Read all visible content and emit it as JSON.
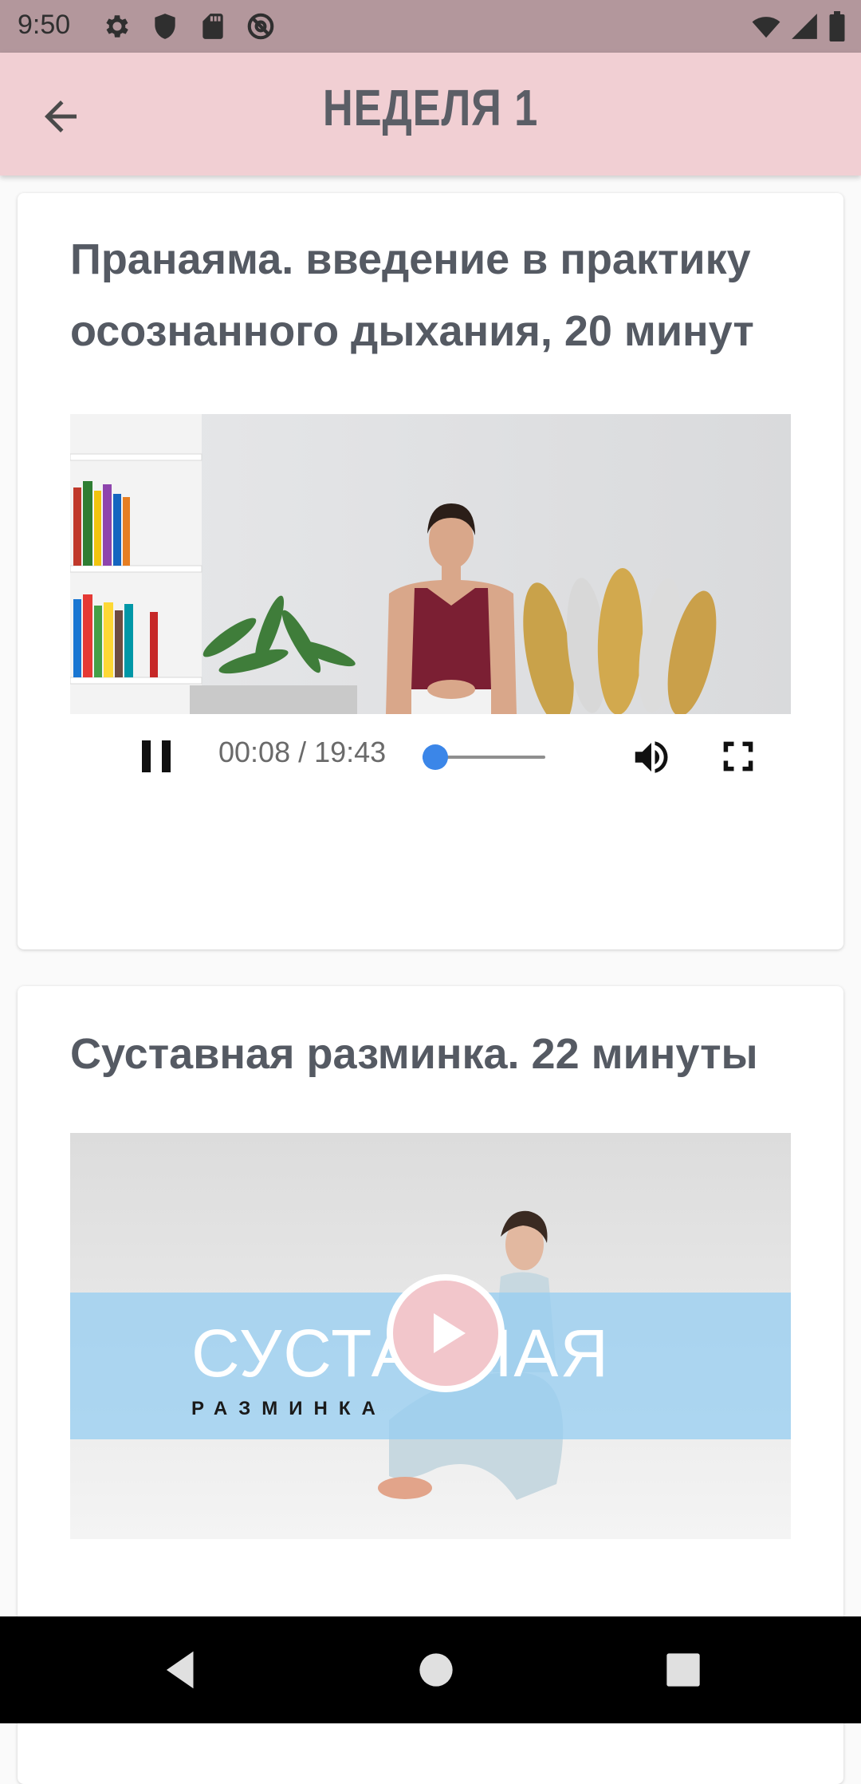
{
  "status_bar": {
    "time": "9:50",
    "icons_left": [
      "settings-icon",
      "shield-icon",
      "sd-card-icon",
      "at-sign-icon"
    ],
    "icons_right": [
      "wifi-icon",
      "signal-icon",
      "battery-icon"
    ]
  },
  "app_bar": {
    "title": "НЕДЕЛЯ 1",
    "back_icon": "arrow-back-icon",
    "background": "#f1cfd3"
  },
  "lessons": [
    {
      "title": "Пранаяма. введение в практику осознанного дыхания, 20 минут",
      "video": {
        "state": "playing",
        "time_text": "00:08 / 19:43",
        "progress": 0.007,
        "controls": [
          "pause-icon",
          "volume-icon",
          "fullscreen-icon"
        ]
      }
    },
    {
      "title": "Суставная разминка. 22 минуты",
      "thumbnail": {
        "title": "СУСТАВНАЯ",
        "subtitle": "РАЗМИНКА",
        "state": "paused",
        "play_icon": "play-icon"
      }
    }
  ],
  "colors": {
    "accent_blue": "#3b86e8",
    "play_button": "#f2c6cb",
    "thumbnail_band": "#aad7f5"
  },
  "nav_bar": {
    "icons": [
      "nav-back-icon",
      "nav-home-icon",
      "nav-recents-icon"
    ]
  }
}
